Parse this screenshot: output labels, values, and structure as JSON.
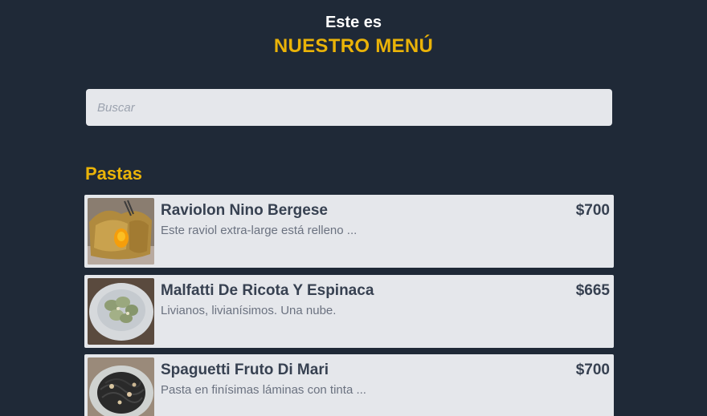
{
  "header": {
    "subtitle": "Este es",
    "title": "NUESTRO MENÚ"
  },
  "search": {
    "placeholder": "Buscar",
    "value": ""
  },
  "categories": [
    {
      "name": "Pastas",
      "items": [
        {
          "name": "Raviolon Nino Bergese",
          "description": "Este raviol extra-large está relleno ...",
          "price": "$700",
          "image_icon": "ravioli-photo"
        },
        {
          "name": "Malfatti De Ricota Y Espinaca",
          "description": "Livianos, livianísimos. Una nube.",
          "price": "$665",
          "image_icon": "malfatti-photo"
        },
        {
          "name": "Spaguetti Fruto Di Mari",
          "description": "Pasta en finísimas láminas con tinta ...",
          "price": "$700",
          "image_icon": "spaghetti-photo"
        }
      ]
    }
  ],
  "colors": {
    "background": "#1f2937",
    "accent": "#eab308",
    "card": "#e5e7eb",
    "text": "#374151"
  }
}
